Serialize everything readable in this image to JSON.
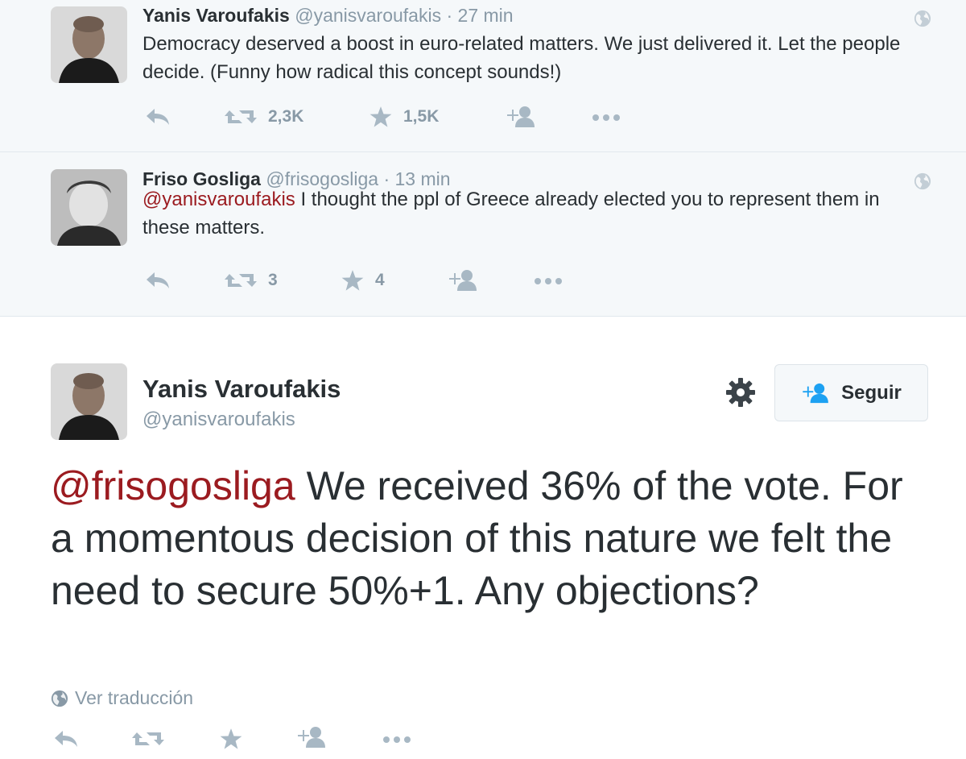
{
  "tweets": [
    {
      "fullname": "Yanis Varoufakis",
      "username": "@yanisvaroufakis",
      "time": "· 27 min",
      "text": "Democracy deserved a boost in euro-related matters. We just delivered it. Let the people decide. (Funny how radical this concept sounds!)",
      "retweets": "2,3K",
      "favorites": "1,5K"
    },
    {
      "fullname": "Friso Gosliga",
      "username": "@frisogosliga",
      "time": "· 13 min",
      "mention": "@yanisvaroufakis",
      "text": " I thought the ppl of Greece already elected you to represent them in these matters.",
      "retweets": "3",
      "favorites": "4"
    }
  ],
  "main": {
    "fullname": "Yanis Varoufakis",
    "username": "@yanisvaroufakis",
    "follow_label": "Seguir",
    "mention": "@frisogosliga",
    "text": " We received 36% of the vote. For a momentous decision of this nature we felt the need to secure 50%+1. Any objections?",
    "translate_label": "Ver traducción"
  },
  "colors": {
    "mention": "#9b1b20",
    "secondary_text": "#8899a6",
    "context_bg": "#f5f8fa"
  },
  "icons": [
    "reply-icon",
    "retweet-icon",
    "favorite-icon",
    "follow-icon",
    "more-icon",
    "globe-icon",
    "gear-icon"
  ]
}
